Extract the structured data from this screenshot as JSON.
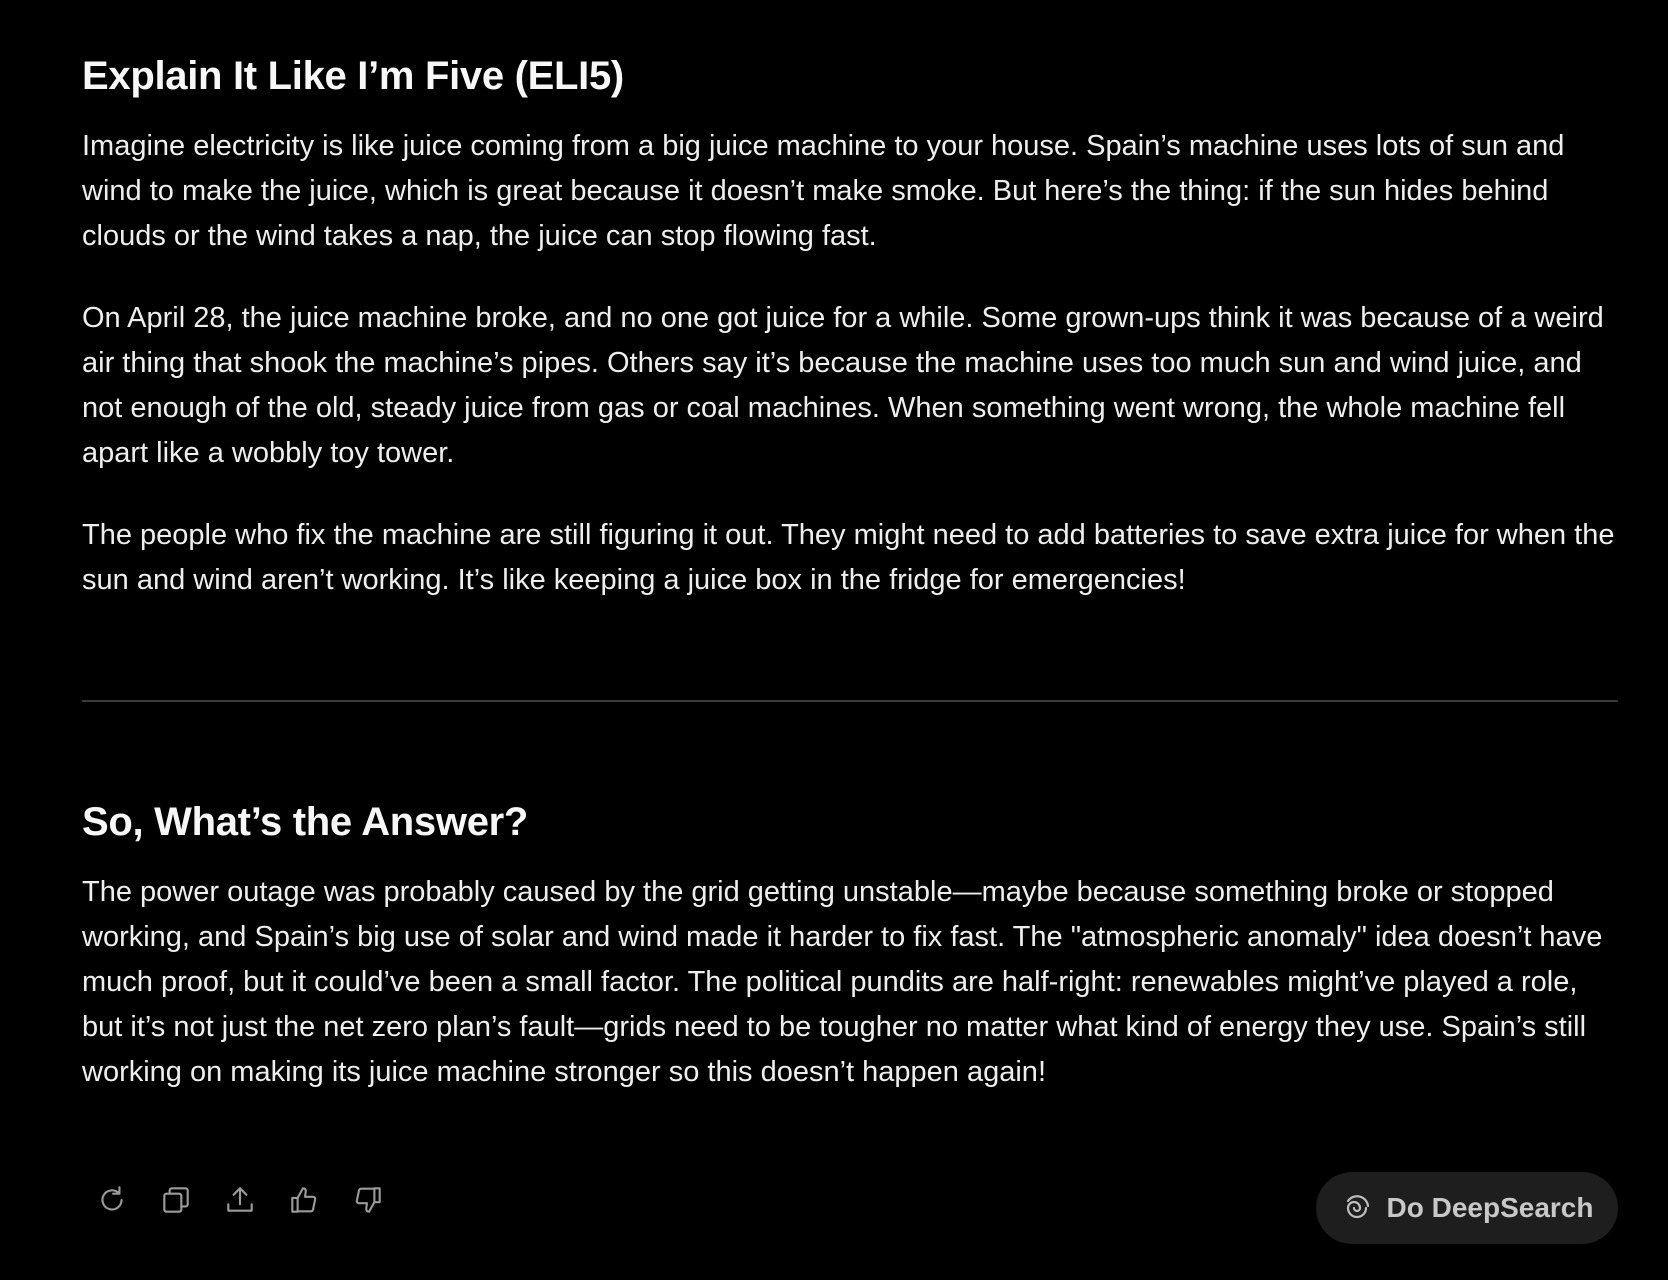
{
  "eli5": {
    "heading": "Explain It Like I’m Five (ELI5)",
    "paragraphs": [
      "Imagine electricity is like juice coming from a big juice machine to your house. Spain’s machine uses lots of sun and wind to make the juice, which is great because it doesn’t make smoke. But here’s the thing: if the sun hides behind clouds or the wind takes a nap, the juice can stop flowing fast.",
      "On April 28, the juice machine broke, and no one got juice for a while. Some grown-ups think it was because of a weird air thing that shook the machine’s pipes. Others say it’s because the machine uses too much sun and wind juice, and not enough of the old, steady juice from gas or coal machines. When something went wrong, the whole machine fell apart like a wobbly toy tower.",
      "The people who fix the machine are still figuring it out. They might need to add batteries to save extra juice for when the sun and wind aren’t working. It’s like keeping a juice box in the fridge for emergencies!"
    ]
  },
  "answer": {
    "heading": "So, What’s the Answer?",
    "paragraph": "The power outage was probably caused by the grid getting unstable—maybe because something broke or stopped working, and Spain’s big use of solar and wind made it harder to fix fast. The \"atmospheric anomaly\" idea doesn’t have much proof, but it could’ve been a small factor. The political pundits are half-right: renewables might’ve played a role, but it’s not just the net zero plan’s fault—grids need to be tougher no matter what kind of energy they use. Spain’s still working on making its juice machine stronger so this doesn’t happen again!"
  },
  "actions": {
    "icons": [
      "regenerate-icon",
      "copy-icon",
      "share-icon",
      "thumbs-up-icon",
      "thumbs-down-icon"
    ],
    "deepsearch_label": "Do DeepSearch"
  },
  "colors": {
    "background": "#000000",
    "text": "#eeeeee",
    "divider": "#3a3a3a",
    "icon": "#9a9a9a",
    "button_bg": "#1e1e1e"
  }
}
